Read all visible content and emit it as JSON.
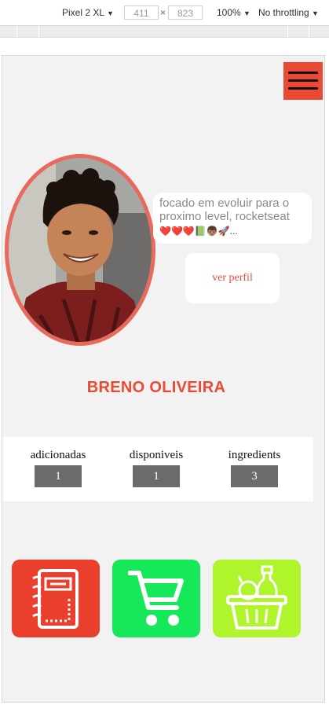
{
  "devtools": {
    "device": "Pixel 2 XL",
    "width": "411",
    "height": "823",
    "times": "×",
    "zoom": "100%",
    "throttling": "No throttling",
    "caret": "▼"
  },
  "menu": {
    "icon": "hamburger-icon"
  },
  "profile": {
    "bio_line1": "focado em evoluir para o",
    "bio_line2": "proximo level, rocketseat",
    "bio_emojis": "❤️❤️❤️📗👦🏽🚀...",
    "view_profile_label": "ver perfil",
    "name": "BRENO OLIVEIRA"
  },
  "stats": [
    {
      "label": "adicionadas",
      "value": "1"
    },
    {
      "label": "disponiveis",
      "value": "1"
    },
    {
      "label": "ingredients",
      "value": "3"
    }
  ],
  "tiles": [
    {
      "icon": "notebook-icon",
      "color": "#ea3f2d"
    },
    {
      "icon": "cart-icon",
      "color": "#16e85a"
    },
    {
      "icon": "grocery-basket-icon",
      "color": "#b0f52c"
    }
  ],
  "colors": {
    "accent": "#ea4a34",
    "avatar_border": "#e86a5c",
    "stat_box": "#6b6b6b",
    "background": "#f2f2f2"
  }
}
